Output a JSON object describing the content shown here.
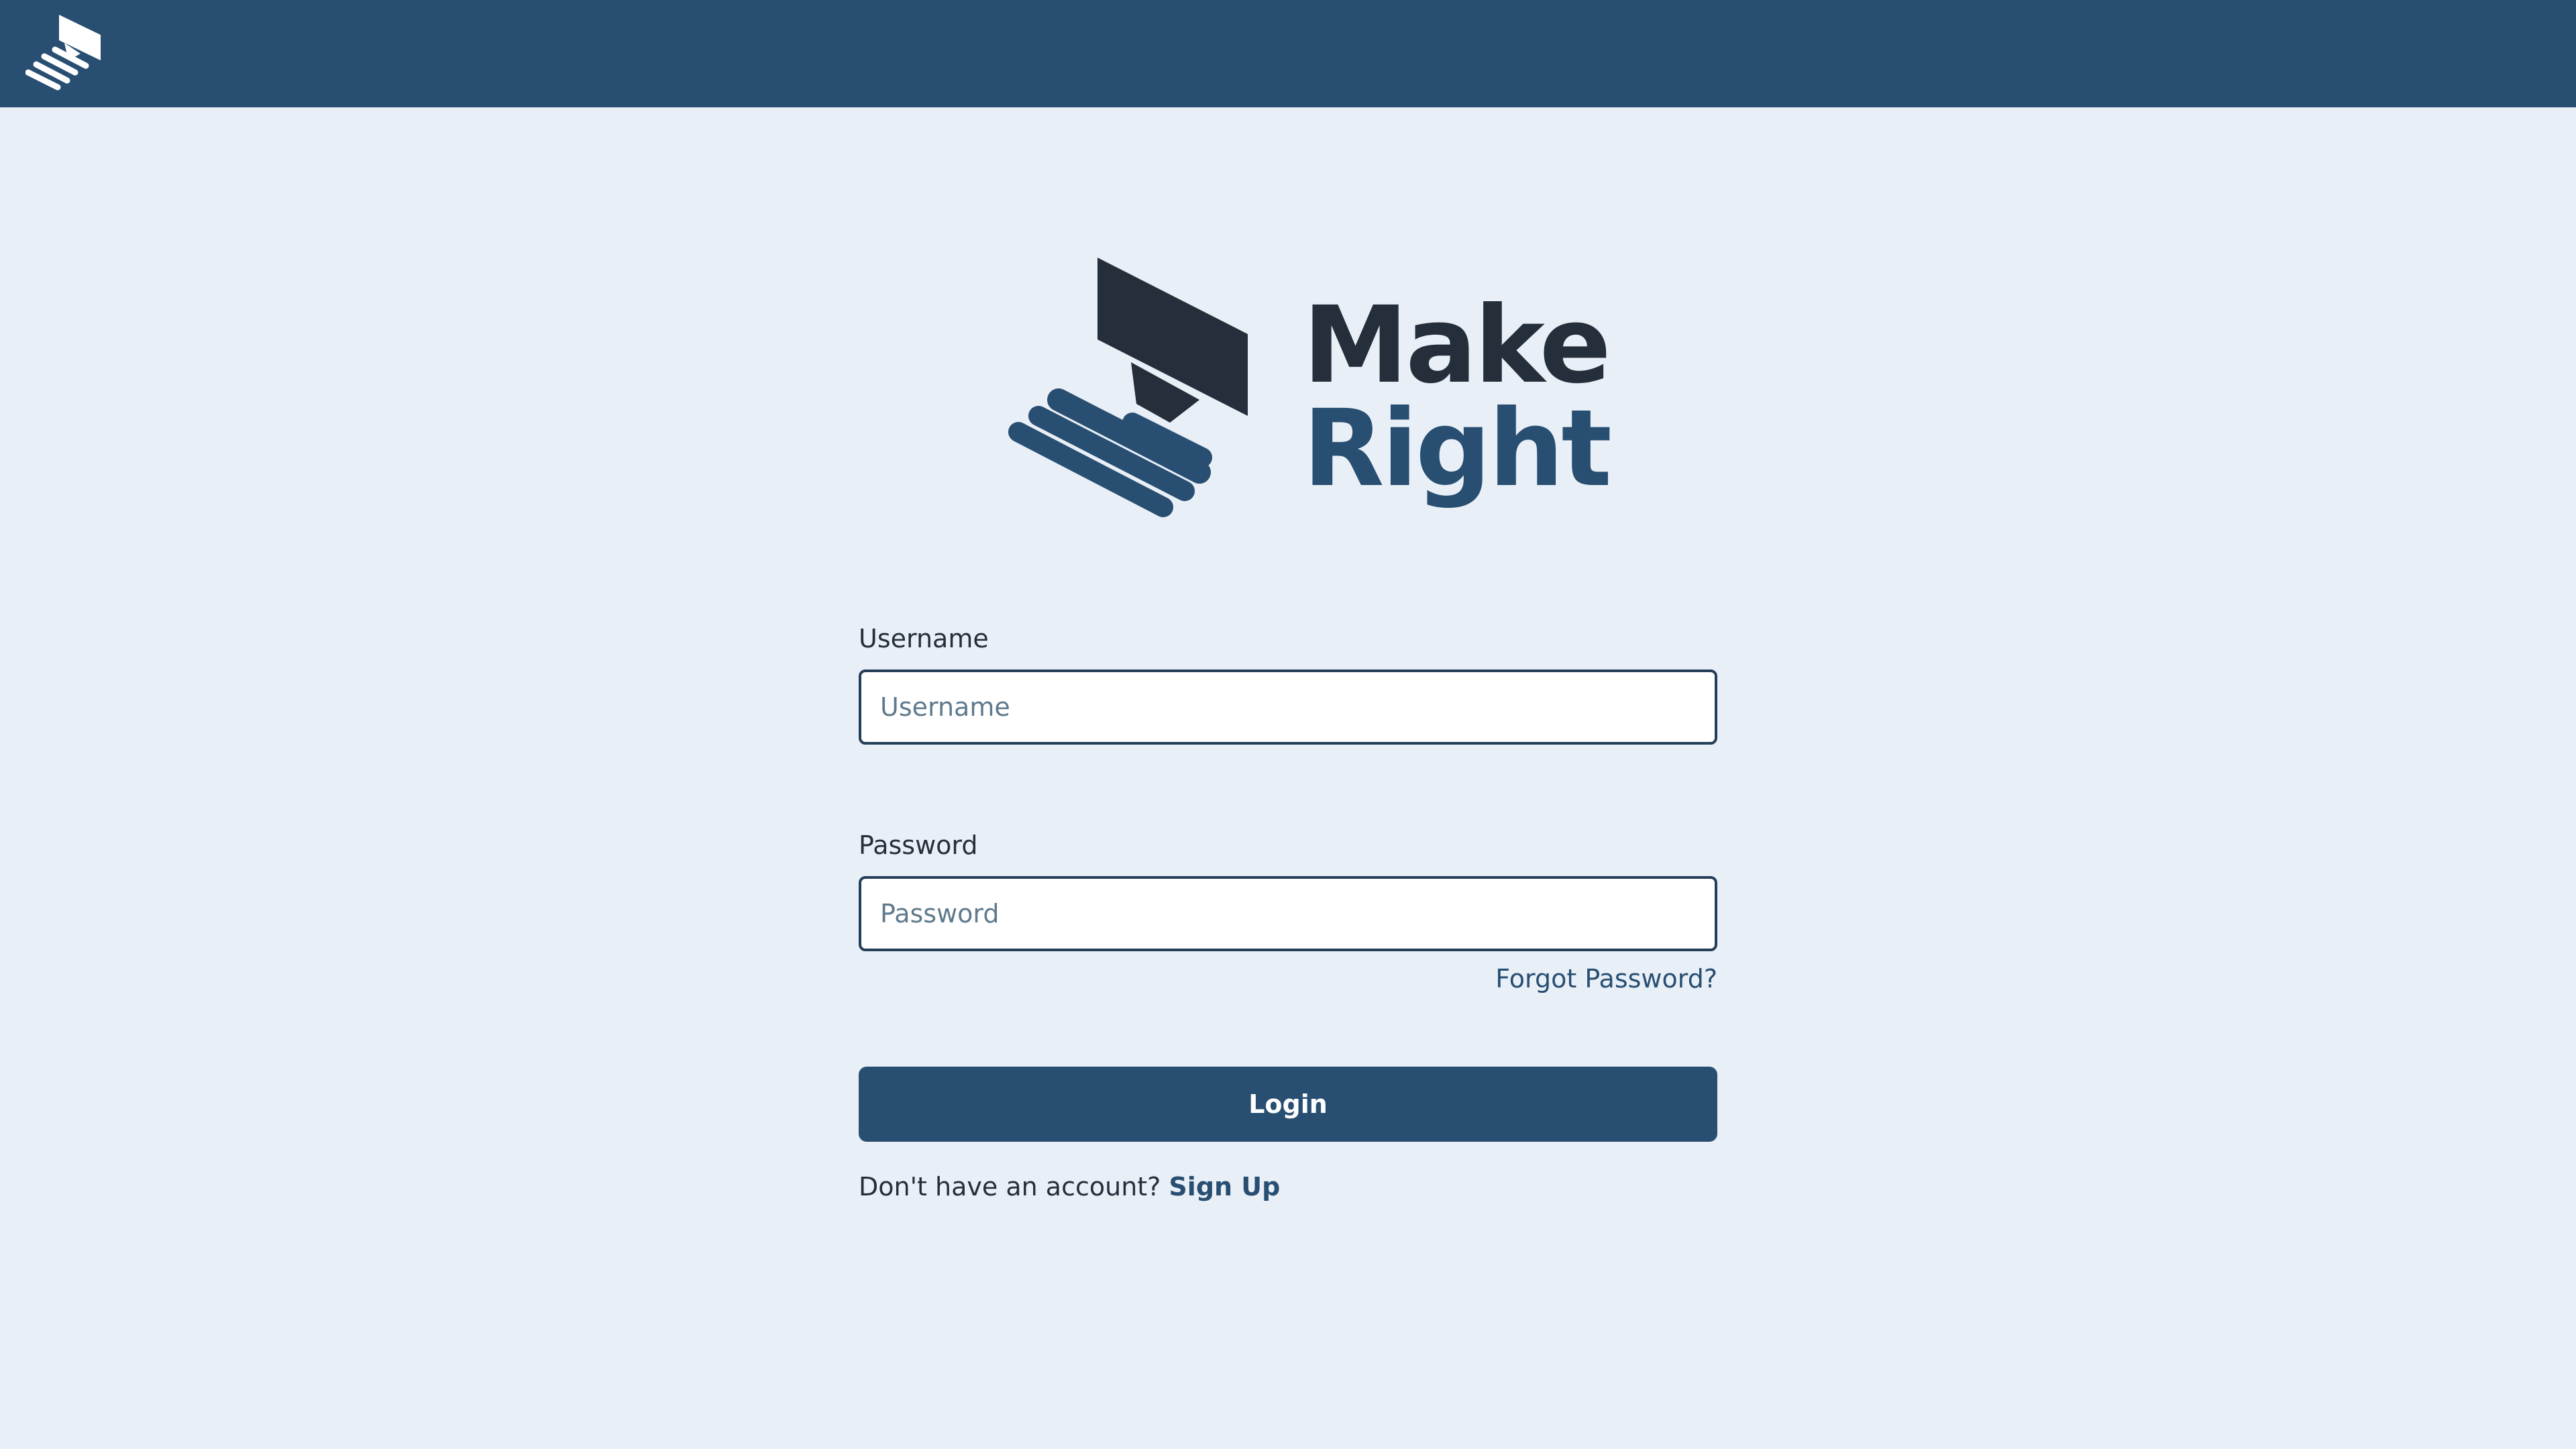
{
  "header": {
    "logo_icon": "make-right-logo-icon"
  },
  "brand": {
    "line1": "Make",
    "line2": "Right",
    "colors": {
      "dark": "#242f3b",
      "primary": "#284f72"
    }
  },
  "login_form": {
    "username_label": "Username",
    "username_placeholder": "Username",
    "username_value": "",
    "password_label": "Password",
    "password_placeholder": "Password",
    "password_value": "",
    "forgot_password": "Forgot Password?",
    "login_button": "Login",
    "no_account_text": "Don't have an account?",
    "sign_up": "Sign Up"
  },
  "theme": {
    "background": "#e9eff7",
    "header_bar": "#284f72",
    "input_border": "#253f5a"
  }
}
